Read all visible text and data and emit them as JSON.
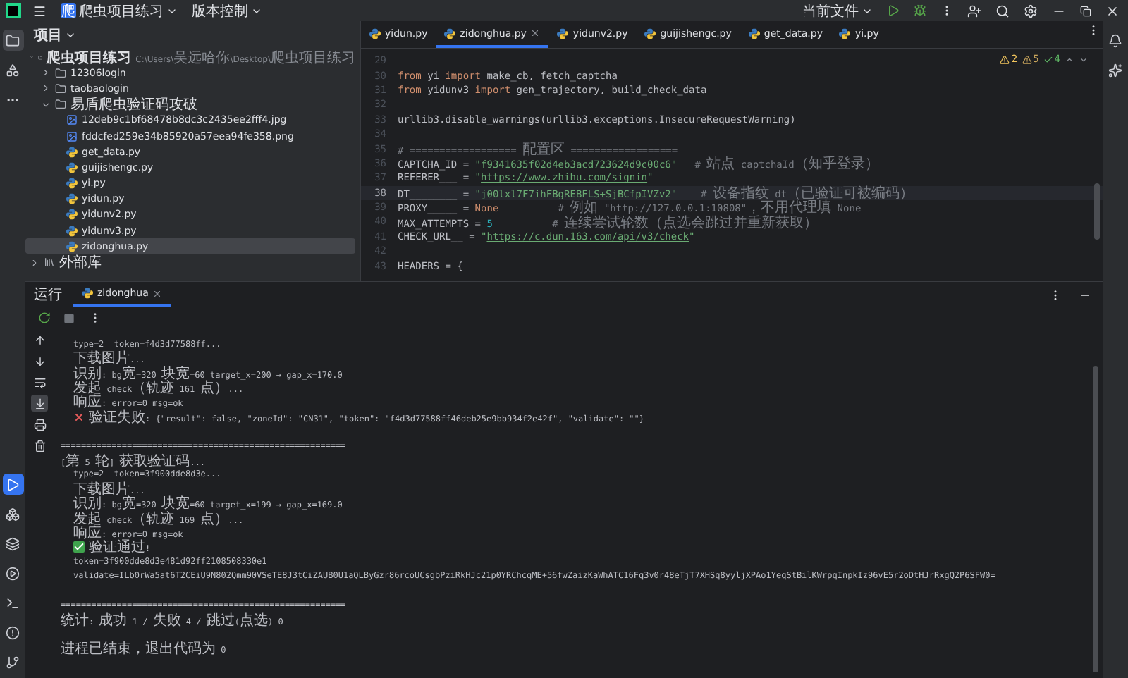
{
  "title_bar": {
    "project": "爬虫项目练习",
    "project_badge": "爬",
    "vcs": "版本控制",
    "run_config": "当前文件"
  },
  "project_panel": {
    "title": "项目",
    "tree": [
      {
        "kind": "folder",
        "label": "爬虫项目练习",
        "path": "C:\\Users\\吴远哈你\\Desktop\\爬虫项目练习",
        "expanded": true,
        "selected": false,
        "children": [
          {
            "kind": "folder",
            "label": "12306login",
            "expanded": false,
            "selected": false
          },
          {
            "kind": "folder",
            "label": "taobaologin",
            "expanded": false,
            "selected": false
          },
          {
            "kind": "folder",
            "label": "易盾爬虫验证码攻破",
            "expanded": true,
            "selected": false,
            "children": [
              {
                "kind": "image",
                "label": "12deb9c1bf68478b8dc3c2435ee2fff4.jpg",
                "selected": false
              },
              {
                "kind": "image",
                "label": "fddcfed259e34b85920a57eea94fe358.png",
                "selected": false
              },
              {
                "kind": "python",
                "label": "get_data.py",
                "selected": false
              },
              {
                "kind": "python",
                "label": "guijishengc.py",
                "selected": false
              },
              {
                "kind": "python",
                "label": "yi.py",
                "selected": false
              },
              {
                "kind": "python",
                "label": "yidun.py",
                "selected": false
              },
              {
                "kind": "python",
                "label": "yidunv2.py",
                "selected": false
              },
              {
                "kind": "python",
                "label": "yidunv3.py",
                "selected": false
              },
              {
                "kind": "python",
                "label": "zidonghua.py",
                "selected": true
              }
            ]
          }
        ]
      },
      {
        "kind": "library",
        "label": "外部库",
        "expanded": false,
        "selected": false
      }
    ]
  },
  "editor": {
    "tabs": [
      {
        "label": "yidun.py",
        "selected": false
      },
      {
        "label": "zidonghua.py",
        "selected": true
      },
      {
        "label": "yidunv2.py",
        "selected": false
      },
      {
        "label": "guijishengc.py",
        "selected": false
      },
      {
        "label": "get_data.py",
        "selected": false
      },
      {
        "label": "yi.py",
        "selected": false
      }
    ],
    "inspections": {
      "errors": "2",
      "warnings": "5",
      "typos": "4"
    },
    "lines": [
      {
        "number": "29",
        "current": false
      },
      {
        "number": "30",
        "current": false,
        "tokens": [
          {
            "kind": "keyword",
            "text": "from"
          },
          {
            "kind": "plain",
            "text": " yi "
          },
          {
            "kind": "keyword",
            "text": "import"
          },
          {
            "kind": "plain",
            "text": " make_cb, fetch_captcha"
          }
        ]
      },
      {
        "number": "31",
        "current": false,
        "tokens": [
          {
            "kind": "keyword",
            "text": "from"
          },
          {
            "kind": "plain",
            "text": " yidunv3 "
          },
          {
            "kind": "keyword",
            "text": "import"
          },
          {
            "kind": "plain",
            "text": " gen_trajectory, build_check_data"
          }
        ]
      },
      {
        "number": "32",
        "current": false
      },
      {
        "number": "33",
        "current": false,
        "tokens": [
          {
            "kind": "plain",
            "text": "urllib3.disable_warnings(urllib3.exceptions.InsecureRequestWarning)"
          }
        ]
      },
      {
        "number": "34",
        "current": false
      },
      {
        "number": "35",
        "current": false,
        "tokens": [
          {
            "kind": "comment",
            "text": "# ================== 配置区 =================="
          }
        ]
      },
      {
        "number": "36",
        "current": false,
        "tokens": [
          {
            "kind": "plain",
            "text": "CAPTCHA_ID = "
          },
          {
            "kind": "string",
            "text": "\"f9341635f02d4eb3acd723624d9c00c6\""
          },
          {
            "kind": "comment",
            "text": "   # 站点 captchaId（知乎登录）"
          }
        ]
      },
      {
        "number": "37",
        "current": false,
        "tokens": [
          {
            "kind": "plain",
            "text": "REFERER___ = "
          },
          {
            "kind": "string",
            "text": "\""
          },
          {
            "kind": "url",
            "text": "https://www.zhihu.com/signin"
          },
          {
            "kind": "string",
            "text": "\""
          }
        ]
      },
      {
        "number": "38",
        "current": true,
        "tokens": [
          {
            "kind": "plain",
            "text": "DT________ = "
          },
          {
            "kind": "string",
            "text": "\"j00lxl7F7ihFBgREBFLS+SjBCfpIVZv2\""
          },
          {
            "kind": "comment",
            "text": "    # 设备指纹 dt（已验证可被编码）"
          }
        ]
      },
      {
        "number": "39",
        "current": false,
        "tokens": [
          {
            "kind": "plain",
            "text": "PROXY_____ = "
          },
          {
            "kind": "keyword",
            "text": "None"
          },
          {
            "kind": "comment",
            "text": "          # 例如 \"http://127.0.0.1:10808\"，不用代理填 None"
          }
        ]
      },
      {
        "number": "40",
        "current": false,
        "tokens": [
          {
            "kind": "plain",
            "text": "MAX_ATTEMPTS = "
          },
          {
            "kind": "number",
            "text": "5"
          },
          {
            "kind": "comment",
            "text": "          # 连续尝试轮数（点选会跳过并重新获取）"
          }
        ]
      },
      {
        "number": "41",
        "current": false,
        "tokens": [
          {
            "kind": "plain",
            "text": "CHECK_URL__ = "
          },
          {
            "kind": "string",
            "text": "\""
          },
          {
            "kind": "url",
            "text": "https://c.dun.163.com/api/v3/check"
          },
          {
            "kind": "string",
            "text": "\""
          }
        ]
      },
      {
        "number": "42",
        "current": false
      },
      {
        "number": "43",
        "current": false,
        "tokens": [
          {
            "kind": "plain",
            "text": "HEADERS = {"
          }
        ]
      }
    ]
  },
  "run_panel": {
    "title": "运行",
    "tabs": [
      {
        "label": "zidonghua",
        "selected": true
      }
    ],
    "console": [
      {
        "kind": "indent",
        "text": "type=2  token=f4d3d77588ff..."
      },
      {
        "kind": "indent",
        "text": "下载图片..."
      },
      {
        "kind": "indent",
        "text": "识别: bg宽=320 块宽=60 target_x=200 → gap_x=170.0"
      },
      {
        "kind": "indent",
        "text": "发起 check（轨迹 161 点）..."
      },
      {
        "kind": "indent",
        "text": "响应: error=0 msg=ok"
      },
      {
        "kind": "error",
        "text": "验证失败: {\"result\": false, \"zoneId\": \"CN31\", \"token\": \"f4d3d77588ff46deb25e9bb934f2e42f\", \"validate\": \"\"}"
      },
      {
        "kind": "blank"
      },
      {
        "kind": "plain",
        "text": "========================================================"
      },
      {
        "kind": "plain",
        "text": "[第 5 轮] 获取验证码..."
      },
      {
        "kind": "indent",
        "text": "type=2  token=3f900dde8d3e..."
      },
      {
        "kind": "indent",
        "text": "下载图片..."
      },
      {
        "kind": "indent",
        "text": "识别: bg宽=320 块宽=60 target_x=199 → gap_x=169.0"
      },
      {
        "kind": "indent",
        "text": "发起 check（轨迹 169 点）..."
      },
      {
        "kind": "indent",
        "text": "响应: error=0 msg=ok"
      },
      {
        "kind": "success",
        "text": "验证通过!"
      },
      {
        "kind": "indent",
        "text": "token=3f900dde8d3e481d92ff2108508330e1"
      },
      {
        "kind": "indent",
        "text": "validate=ILb0rWa5at6T2CEiU9N802Qmm90VSeTE8J3tCiZAUB0U1aQLByGzr86rcoUCsgbPziRkHJc21p0YRChcqME+56fwZaizKaWhATC16Fq3v0r48eTjT7XHSq8yyljXPAo1YeqStBilKWrpqInpkIz96vE5r2oDtHJrRxgQ2P6SFW0="
      },
      {
        "kind": "blank"
      },
      {
        "kind": "plain",
        "text": "========================================================"
      },
      {
        "kind": "plain",
        "text": "统计: 成功 1 / 失败 4 / 跳过(点选) 0"
      },
      {
        "kind": "blank"
      },
      {
        "kind": "plain",
        "text": "进程已结束，退出代码为 0"
      }
    ]
  }
}
